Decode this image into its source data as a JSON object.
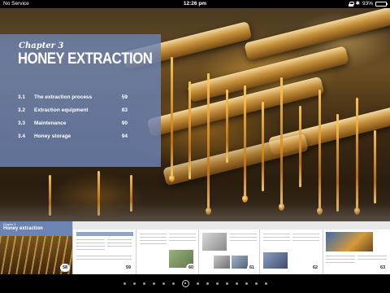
{
  "status_bar": {
    "carrier": "No Service",
    "time": "12:26 pm",
    "battery": "93%",
    "battery_level": 0.93,
    "icons": [
      "lock-icon",
      "bluetooth-icon",
      "battery-icon"
    ]
  },
  "chapter": {
    "number": "Chapter 3",
    "title": "HONEY EXTRACTION",
    "toc": [
      {
        "num": "3.1",
        "label": "The extraction process",
        "page": "59"
      },
      {
        "num": "3.2",
        "label": "Extraction equipment",
        "page": "83"
      },
      {
        "num": "3.3",
        "label": "Maintenance",
        "page": "90"
      },
      {
        "num": "3.4",
        "label": "Honey storage",
        "page": "94"
      }
    ]
  },
  "thumbnails": {
    "first": {
      "overline": "Chapter 3",
      "title": "Honey extraction",
      "page": "58"
    },
    "pages": [
      "59",
      "60",
      "61",
      "62",
      "63"
    ]
  },
  "pager": {
    "dot_count": 15,
    "current_index": 6
  },
  "colors": {
    "panel": "#6c84b4",
    "battery": "#4cd964"
  }
}
